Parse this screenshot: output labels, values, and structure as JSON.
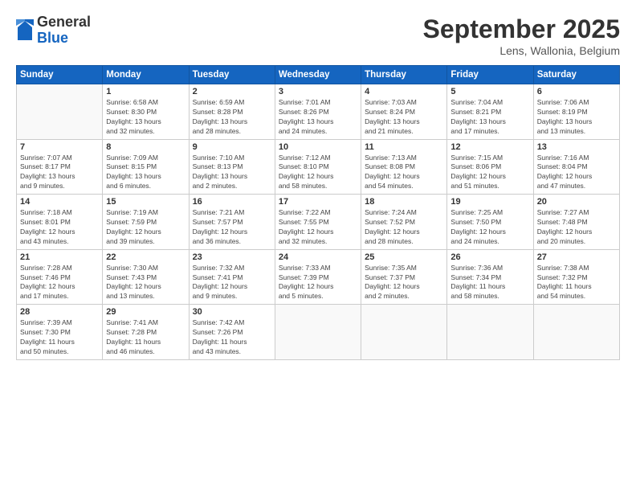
{
  "logo": {
    "general": "General",
    "blue": "Blue"
  },
  "header": {
    "title": "September 2025",
    "subtitle": "Lens, Wallonia, Belgium"
  },
  "weekdays": [
    "Sunday",
    "Monday",
    "Tuesday",
    "Wednesday",
    "Thursday",
    "Friday",
    "Saturday"
  ],
  "weeks": [
    [
      {
        "day": "",
        "info": ""
      },
      {
        "day": "1",
        "info": "Sunrise: 6:58 AM\nSunset: 8:30 PM\nDaylight: 13 hours\nand 32 minutes."
      },
      {
        "day": "2",
        "info": "Sunrise: 6:59 AM\nSunset: 8:28 PM\nDaylight: 13 hours\nand 28 minutes."
      },
      {
        "day": "3",
        "info": "Sunrise: 7:01 AM\nSunset: 8:26 PM\nDaylight: 13 hours\nand 24 minutes."
      },
      {
        "day": "4",
        "info": "Sunrise: 7:03 AM\nSunset: 8:24 PM\nDaylight: 13 hours\nand 21 minutes."
      },
      {
        "day": "5",
        "info": "Sunrise: 7:04 AM\nSunset: 8:21 PM\nDaylight: 13 hours\nand 17 minutes."
      },
      {
        "day": "6",
        "info": "Sunrise: 7:06 AM\nSunset: 8:19 PM\nDaylight: 13 hours\nand 13 minutes."
      }
    ],
    [
      {
        "day": "7",
        "info": "Sunrise: 7:07 AM\nSunset: 8:17 PM\nDaylight: 13 hours\nand 9 minutes."
      },
      {
        "day": "8",
        "info": "Sunrise: 7:09 AM\nSunset: 8:15 PM\nDaylight: 13 hours\nand 6 minutes."
      },
      {
        "day": "9",
        "info": "Sunrise: 7:10 AM\nSunset: 8:13 PM\nDaylight: 13 hours\nand 2 minutes."
      },
      {
        "day": "10",
        "info": "Sunrise: 7:12 AM\nSunset: 8:10 PM\nDaylight: 12 hours\nand 58 minutes."
      },
      {
        "day": "11",
        "info": "Sunrise: 7:13 AM\nSunset: 8:08 PM\nDaylight: 12 hours\nand 54 minutes."
      },
      {
        "day": "12",
        "info": "Sunrise: 7:15 AM\nSunset: 8:06 PM\nDaylight: 12 hours\nand 51 minutes."
      },
      {
        "day": "13",
        "info": "Sunrise: 7:16 AM\nSunset: 8:04 PM\nDaylight: 12 hours\nand 47 minutes."
      }
    ],
    [
      {
        "day": "14",
        "info": "Sunrise: 7:18 AM\nSunset: 8:01 PM\nDaylight: 12 hours\nand 43 minutes."
      },
      {
        "day": "15",
        "info": "Sunrise: 7:19 AM\nSunset: 7:59 PM\nDaylight: 12 hours\nand 39 minutes."
      },
      {
        "day": "16",
        "info": "Sunrise: 7:21 AM\nSunset: 7:57 PM\nDaylight: 12 hours\nand 36 minutes."
      },
      {
        "day": "17",
        "info": "Sunrise: 7:22 AM\nSunset: 7:55 PM\nDaylight: 12 hours\nand 32 minutes."
      },
      {
        "day": "18",
        "info": "Sunrise: 7:24 AM\nSunset: 7:52 PM\nDaylight: 12 hours\nand 28 minutes."
      },
      {
        "day": "19",
        "info": "Sunrise: 7:25 AM\nSunset: 7:50 PM\nDaylight: 12 hours\nand 24 minutes."
      },
      {
        "day": "20",
        "info": "Sunrise: 7:27 AM\nSunset: 7:48 PM\nDaylight: 12 hours\nand 20 minutes."
      }
    ],
    [
      {
        "day": "21",
        "info": "Sunrise: 7:28 AM\nSunset: 7:46 PM\nDaylight: 12 hours\nand 17 minutes."
      },
      {
        "day": "22",
        "info": "Sunrise: 7:30 AM\nSunset: 7:43 PM\nDaylight: 12 hours\nand 13 minutes."
      },
      {
        "day": "23",
        "info": "Sunrise: 7:32 AM\nSunset: 7:41 PM\nDaylight: 12 hours\nand 9 minutes."
      },
      {
        "day": "24",
        "info": "Sunrise: 7:33 AM\nSunset: 7:39 PM\nDaylight: 12 hours\nand 5 minutes."
      },
      {
        "day": "25",
        "info": "Sunrise: 7:35 AM\nSunset: 7:37 PM\nDaylight: 12 hours\nand 2 minutes."
      },
      {
        "day": "26",
        "info": "Sunrise: 7:36 AM\nSunset: 7:34 PM\nDaylight: 11 hours\nand 58 minutes."
      },
      {
        "day": "27",
        "info": "Sunrise: 7:38 AM\nSunset: 7:32 PM\nDaylight: 11 hours\nand 54 minutes."
      }
    ],
    [
      {
        "day": "28",
        "info": "Sunrise: 7:39 AM\nSunset: 7:30 PM\nDaylight: 11 hours\nand 50 minutes."
      },
      {
        "day": "29",
        "info": "Sunrise: 7:41 AM\nSunset: 7:28 PM\nDaylight: 11 hours\nand 46 minutes."
      },
      {
        "day": "30",
        "info": "Sunrise: 7:42 AM\nSunset: 7:26 PM\nDaylight: 11 hours\nand 43 minutes."
      },
      {
        "day": "",
        "info": ""
      },
      {
        "day": "",
        "info": ""
      },
      {
        "day": "",
        "info": ""
      },
      {
        "day": "",
        "info": ""
      }
    ]
  ]
}
